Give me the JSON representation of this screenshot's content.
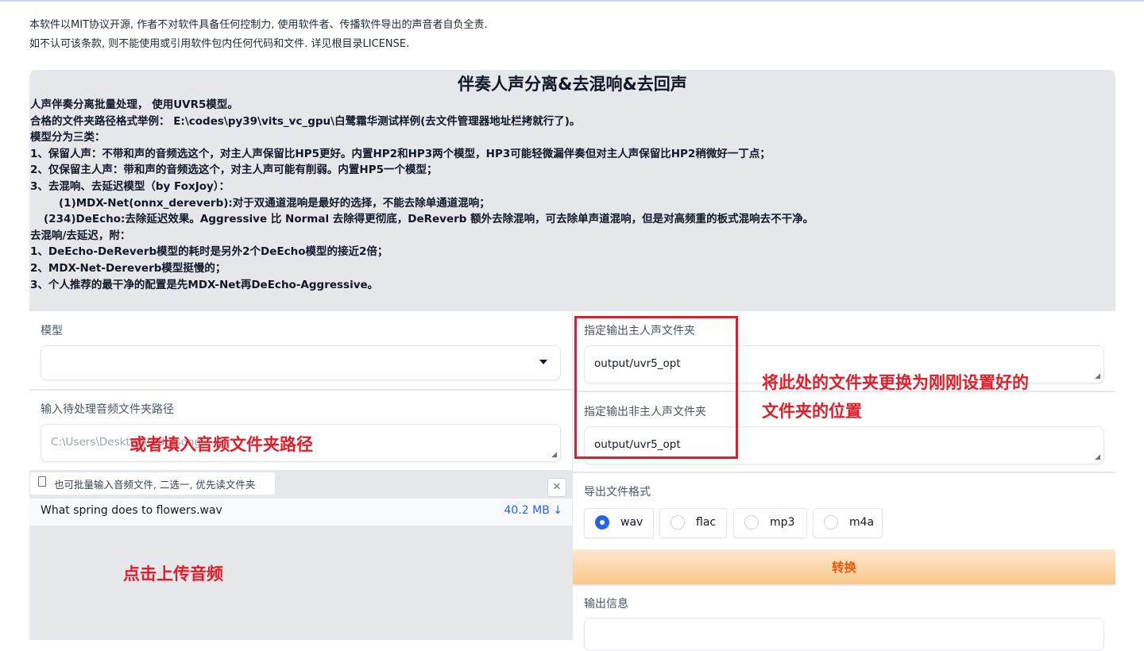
{
  "license": {
    "line1": "本软件以MIT协议开源, 作者不对软件具备任何控制力, 使用软件者、传播软件导出的声音者自负全责.",
    "line2": "如不认可该条款, 则不能使用或引用软件包内任何代码和文件. 详见根目录LICENSE."
  },
  "info": {
    "title": "伴奏人声分离&去混响&去回声",
    "lines": [
      "人声伴奏分离批量处理， 使用UVR5模型。",
      "合格的文件夹路径格式举例： E:\\codes\\py39\\vits_vc_gpu\\白鹭霜华测试样例(去文件管理器地址栏拷就行了)。",
      "模型分为三类：",
      "1、保留人声：不带和声的音频选这个，对主人声保留比HP5更好。内置HP2和HP3两个模型，HP3可能轻微漏伴奏但对主人声保留比HP2稍微好一丁点；",
      "2、仅保留主人声：带和声的音频选这个，对主人声可能有削弱。内置HP5一个模型；",
      "3、去混响、去延迟模型（by FoxJoy）：",
      "(1)MDX-Net(onnx_dereverb):对于双通道混响是最好的选择，不能去除单通道混响；",
      "(234)DeEcho:去除延迟效果。Aggressive 比 Normal 去除得更彻底，DeReverb 额外去除混响，可去除单声道混响，但是对高频重的板式混响去不干净。",
      "去混响/去延迟，附：",
      "1、DeEcho-DeReverb模型的耗时是另外2个DeEcho模型的接近2倍；",
      "2、MDX-Net-Dereverb模型挺慢的；",
      "3、个人推荐的最干净的配置是先MDX-Net再DeEcho-Aggressive。"
    ]
  },
  "left": {
    "model_label": "模型",
    "model_value": "",
    "input_label": "输入待处理音频文件夹路径",
    "input_placeholder": "C:\\Users\\Desktop\\todo-songs",
    "file_hint": "也可批量输入音频文件, 二选一, 优先读文件夹",
    "file_name": "What spring does to flowers.wav",
    "file_size": "40.2 MB ↓"
  },
  "right": {
    "vocal_label": "指定输出主人声文件夹",
    "vocal_value": "output/uvr5_opt",
    "ins_label": "指定输出非主人声文件夹",
    "ins_value": "output/uvr5_opt",
    "format_label": "导出文件格式",
    "formats": [
      "wav",
      "flac",
      "mp3",
      "m4a"
    ],
    "selected_format": "wav",
    "convert_label": "转换",
    "output_label": "输出信息"
  },
  "annotations": {
    "folder_note_1": "将此处的文件夹更换为刚刚设置好的",
    "folder_note_2": "文件夹的位置",
    "input_note": "或者填入音频文件夹路径",
    "upload_note": "点击上传音频"
  },
  "colors": {
    "annotation_red": "#e11d2a",
    "accent_blue": "#2563eb",
    "button_orange": "#ea580c"
  }
}
